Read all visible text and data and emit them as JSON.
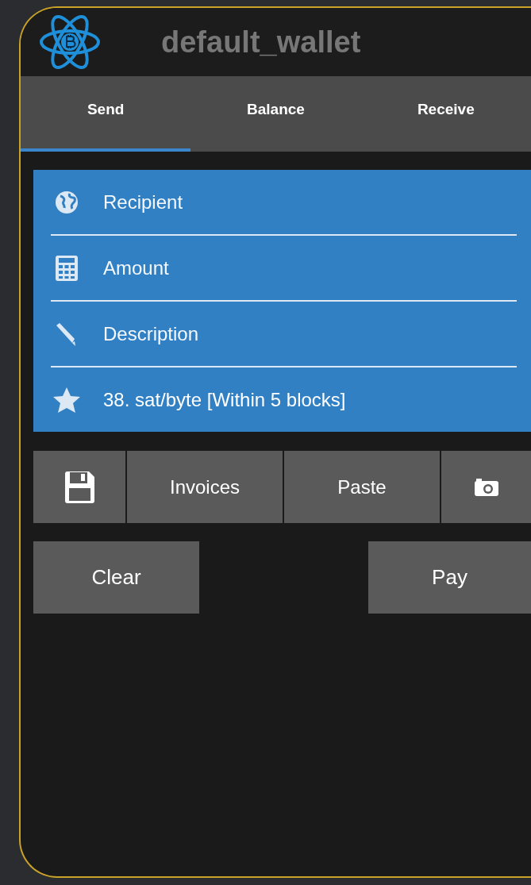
{
  "header": {
    "title": "default_wallet"
  },
  "tabs": [
    {
      "label": "Send",
      "selected": true
    },
    {
      "label": "Balance",
      "selected": false
    },
    {
      "label": "Receive",
      "selected": false
    }
  ],
  "send_form": [
    {
      "kind": "recipient",
      "placeholder": "Recipient"
    },
    {
      "kind": "amount",
      "placeholder": "Amount"
    },
    {
      "kind": "description",
      "placeholder": "Description"
    },
    {
      "kind": "fee",
      "value": "38. sat/byte  [Within 5 blocks]"
    }
  ],
  "toolbar": [
    {
      "kind": "save"
    },
    {
      "kind": "text",
      "label": "Invoices"
    },
    {
      "kind": "text",
      "label": "Paste"
    },
    {
      "kind": "camera"
    }
  ],
  "actions": [
    {
      "label": "Clear"
    },
    {
      "label": "Pay"
    }
  ]
}
